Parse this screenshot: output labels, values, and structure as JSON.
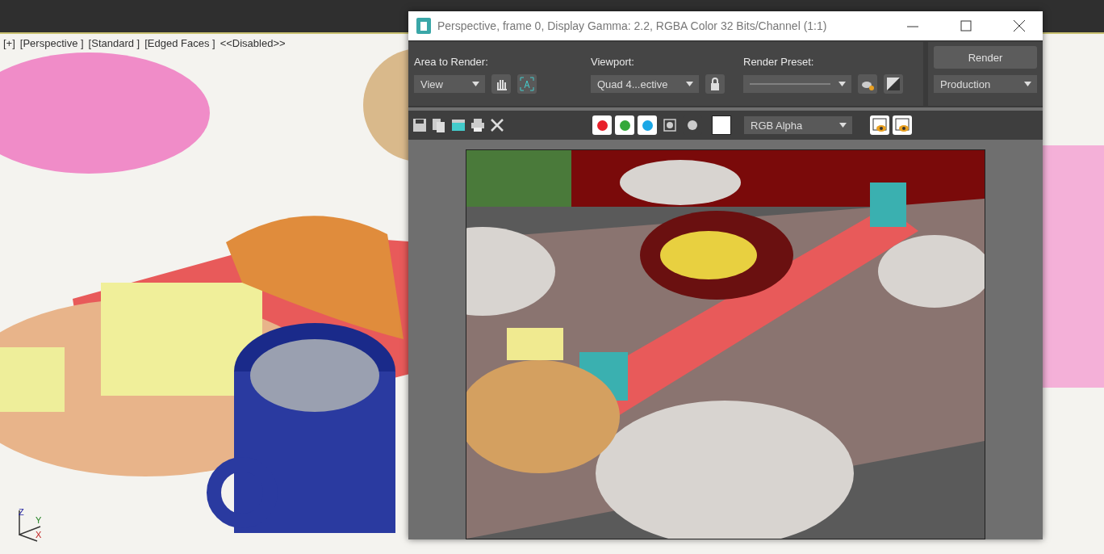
{
  "viewport": {
    "labels": [
      "[+]",
      "[Perspective ]",
      "[Standard ]",
      "[Edged Faces ]",
      "<<Disabled>>"
    ],
    "axes": [
      "Z",
      "Y",
      "X"
    ]
  },
  "render_window": {
    "title": "Perspective, frame 0, Display Gamma: 2.2, RGBA Color 32 Bits/Channel (1:1)",
    "area_to_render": {
      "label": "Area to Render:",
      "value": "View"
    },
    "viewport_field": {
      "label": "Viewport:",
      "value": "Quad 4...ective"
    },
    "render_preset": {
      "label": "Render Preset:"
    },
    "render_button": "Render",
    "render_mode": "Production",
    "channels": [
      {
        "kind": "color",
        "color": "#e8202a",
        "selected": true
      },
      {
        "kind": "color",
        "color": "#34a83a",
        "selected": true
      },
      {
        "kind": "color",
        "color": "#1aa7e6",
        "selected": true
      },
      {
        "kind": "alpha",
        "selected": false
      },
      {
        "kind": "mono",
        "selected": false
      }
    ],
    "channel_display": "RGB Alpha"
  }
}
